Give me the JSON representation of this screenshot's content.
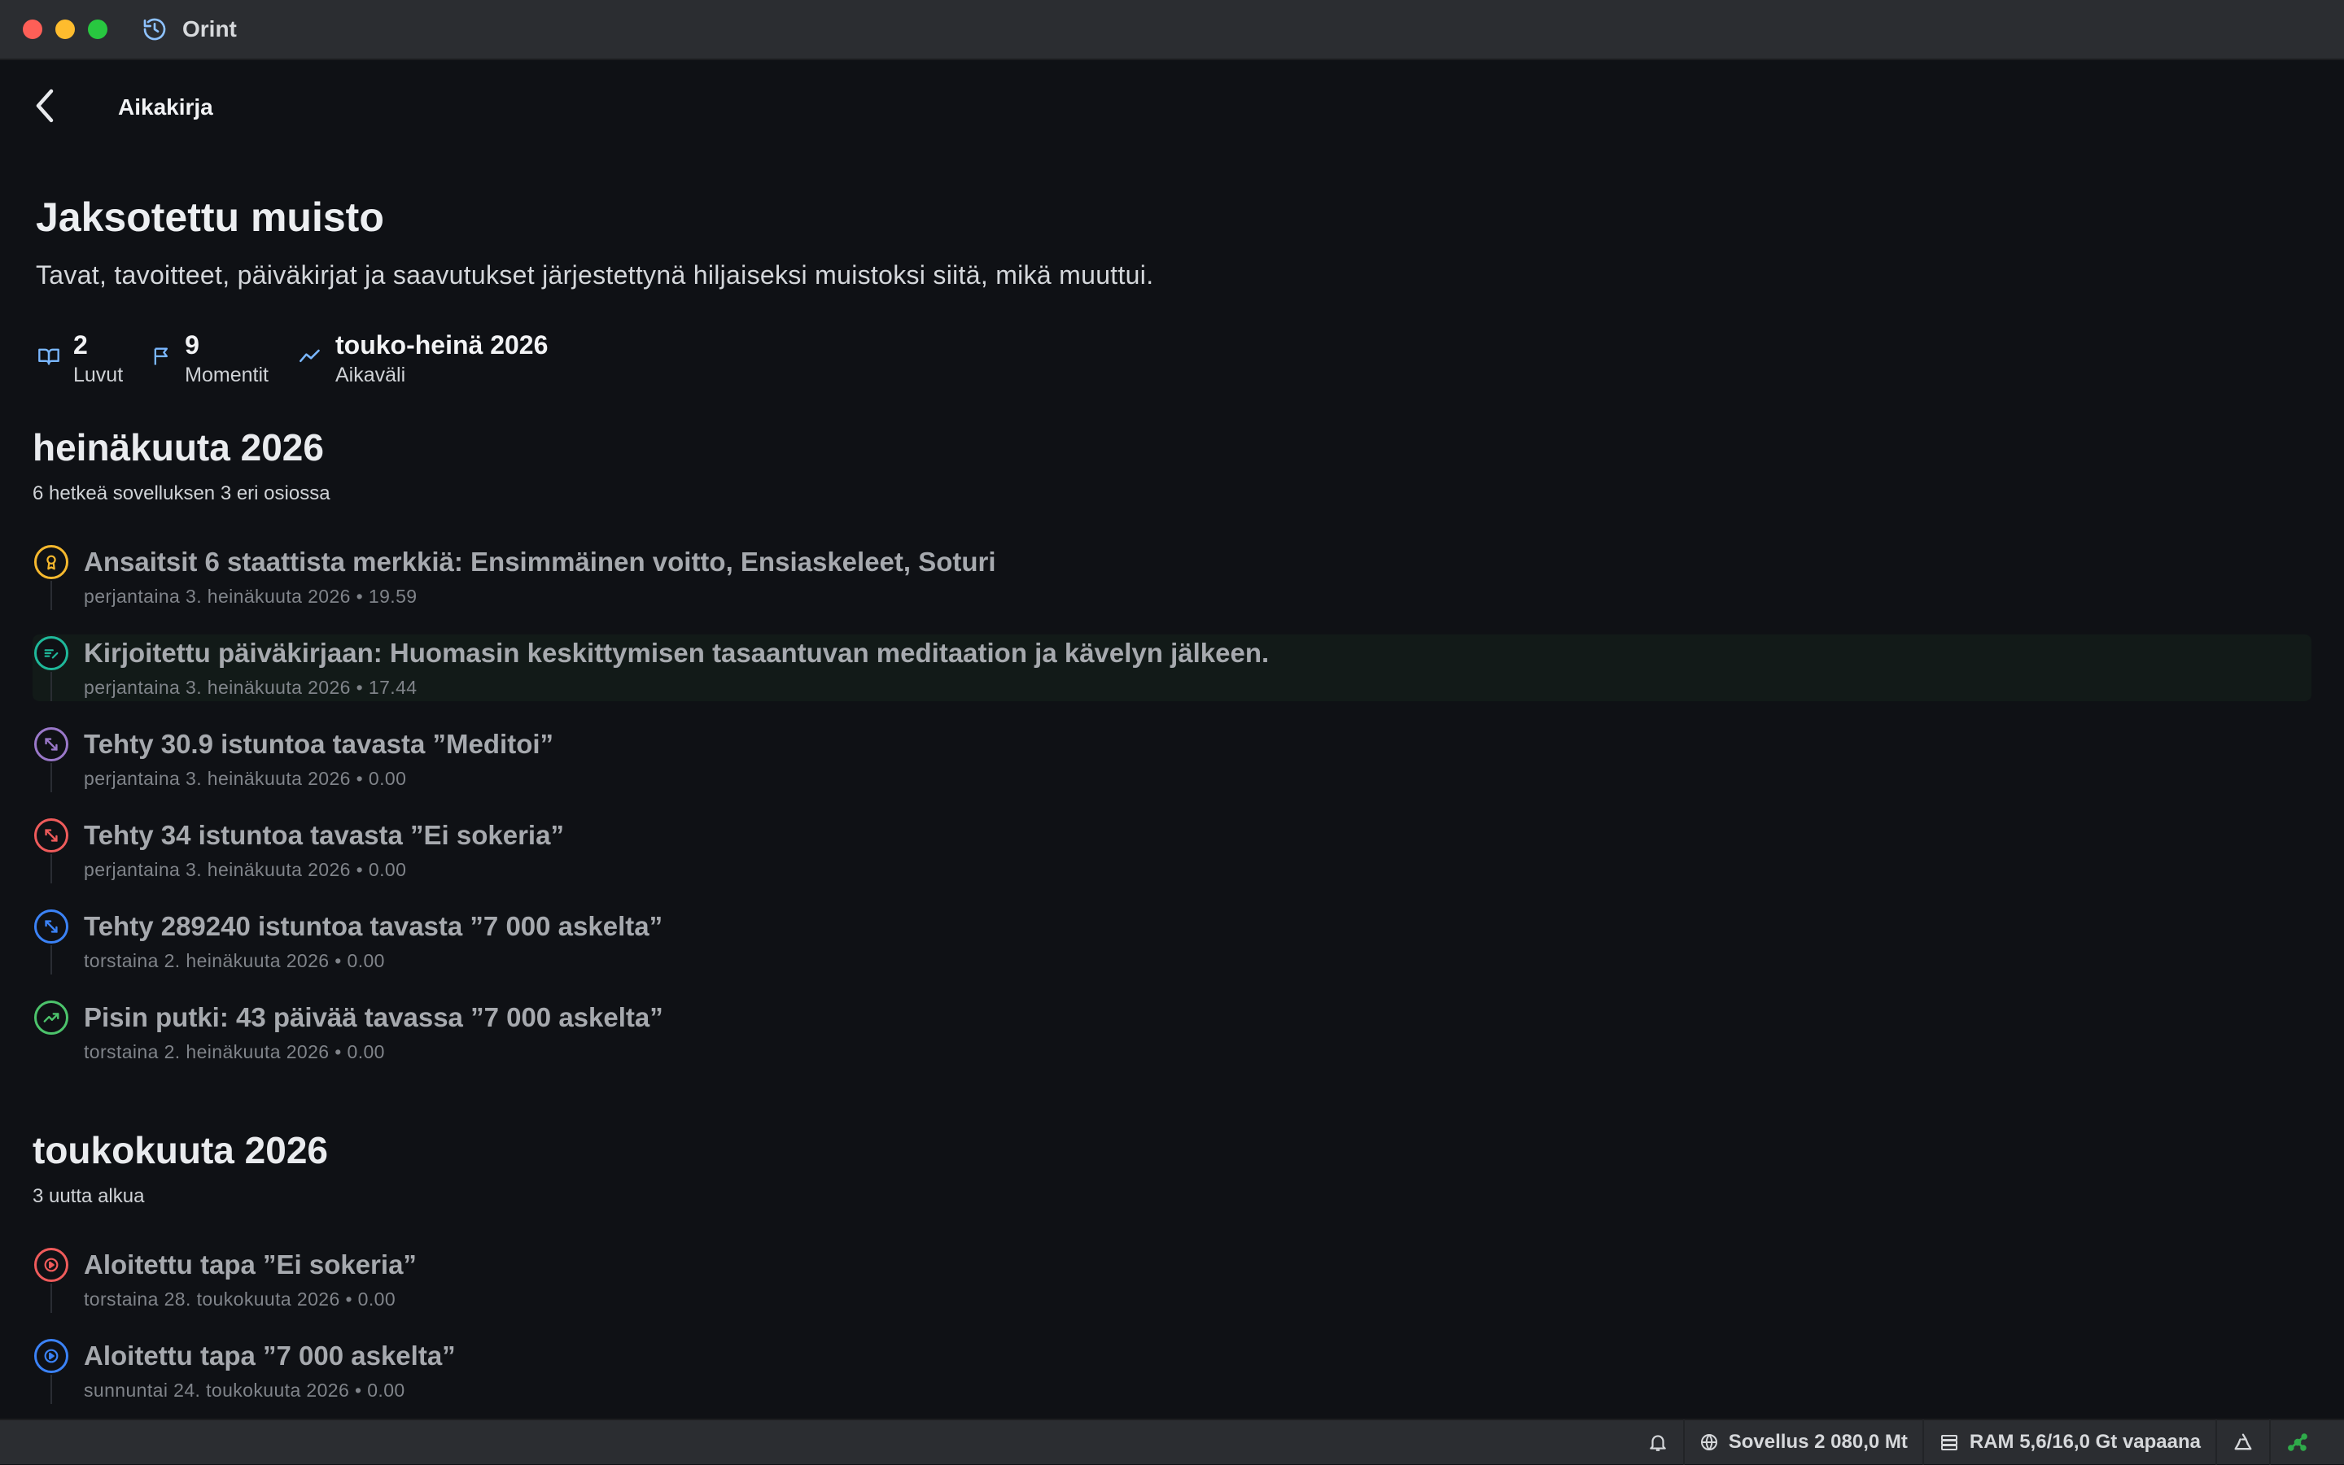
{
  "window": {
    "app_title": "Orint"
  },
  "header": {
    "title": "Aikakirja"
  },
  "page": {
    "title": "Jaksotettu muisto",
    "subtitle": "Tavat, tavoitteet, päiväkirjat ja saavutukset järjestettynä hiljaiseksi muistoksi siitä, mikä muuttui."
  },
  "stats": [
    {
      "value": "2",
      "label": "Luvut",
      "icon": "book-open-icon"
    },
    {
      "value": "9",
      "label": "Momentit",
      "icon": "flag-icon"
    },
    {
      "value": "touko-heinä 2026",
      "label": "Aikaväli",
      "icon": "trend-line-icon"
    }
  ],
  "sections": [
    {
      "title": "heinäkuuta 2026",
      "subtitle": "6 hetkeä sovelluksen 3 eri osiossa",
      "events": [
        {
          "title": "Ansaitsit 6 staattista merkkiä: Ensimmäinen voitto, Ensiaskeleet, Soturi",
          "meta": "perjantaina 3. heinäkuuta 2026 • 19.59",
          "icon": "award-icon",
          "color": "#f5b82e"
        },
        {
          "title": "Kirjoitettu päiväkirjaan: Huomasin keskittymisen tasaantuvan meditaation ja kävelyn jälkeen.",
          "meta": "perjantaina 3. heinäkuuta 2026 • 17.44",
          "icon": "journal-pen-icon",
          "color": "#1fb89a"
        },
        {
          "title": "Tehty 30.9 istuntoa tavasta ”Meditoi”",
          "meta": "perjantaina 3. heinäkuuta 2026 • 0.00",
          "icon": "arrows-diagonal-icon",
          "color": "#9a78c9"
        },
        {
          "title": "Tehty 34 istuntoa tavasta ”Ei sokeria”",
          "meta": "perjantaina 3. heinäkuuta 2026 • 0.00",
          "icon": "arrows-diagonal-icon",
          "color": "#ef5b5b"
        },
        {
          "title": "Tehty 289240 istuntoa tavasta ”7 000 askelta”",
          "meta": "torstaina 2. heinäkuuta 2026 • 0.00",
          "icon": "arrows-diagonal-icon",
          "color": "#3b82f6"
        },
        {
          "title": "Pisin putki: 43 päivää tavassa ”7 000 askelta”",
          "meta": "torstaina 2. heinäkuuta 2026 • 0.00",
          "icon": "trend-up-icon",
          "color": "#4cc36b"
        }
      ]
    },
    {
      "title": "toukokuuta 2026",
      "subtitle": "3 uutta alkua",
      "events": [
        {
          "title": "Aloitettu tapa ”Ei sokeria”",
          "meta": "torstaina 28. toukokuuta 2026 • 0.00",
          "icon": "play-circle-icon",
          "color": "#ef5b5b"
        },
        {
          "title": "Aloitettu tapa ”7 000 askelta”",
          "meta": "sunnuntai 24. toukokuuta 2026 • 0.00",
          "icon": "play-circle-icon",
          "color": "#3b82f6"
        }
      ]
    }
  ],
  "statusbar": {
    "app_memory": "Sovellus 2 080,0 Mt",
    "ram": "RAM 5,6/16,0 Gt vapaana"
  },
  "colors": {
    "background": "#0f1115",
    "chrome": "#2b2d31",
    "accent_blue": "#7ab7ff"
  }
}
